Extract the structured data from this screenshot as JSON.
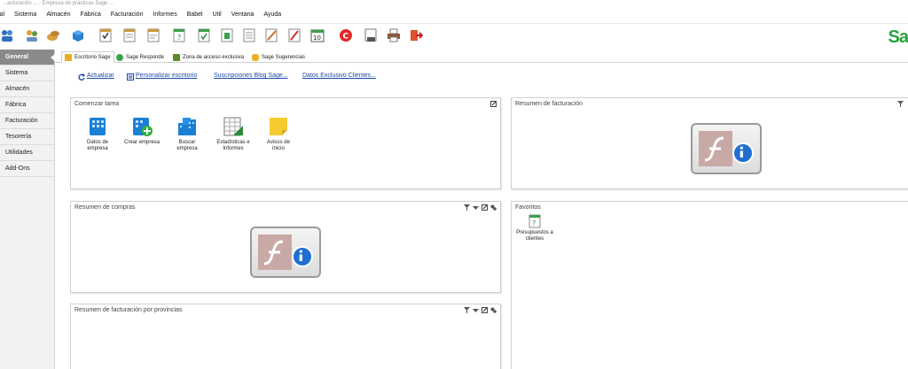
{
  "window": {
    "title": "...acturación ... - Empresa de prácticas Sage ..."
  },
  "menu": [
    "ial",
    "Sistema",
    "Almacén",
    "Fábrica",
    "Facturación",
    "Informes",
    "Babel",
    "Util",
    "Ventana",
    "Ayuda"
  ],
  "toolbar": {
    "icons": [
      "users-icon",
      "people-icon",
      "coins-icon",
      "box-icon",
      "check-document-icon",
      "document-icon",
      "list-icon",
      "question-doc-icon",
      "check-doc-icon",
      "green-doc-icon",
      "doc-icon",
      "edit-doc-icon",
      "cancel-doc-icon",
      "calendar-10-icon",
      "red-c-icon",
      "stamp-icon",
      "printer-icon",
      "exit-icon"
    ],
    "brand": "Sa"
  },
  "sidebar": {
    "items": [
      {
        "label": "General",
        "active": true
      },
      {
        "label": "Sistema",
        "active": false
      },
      {
        "label": "Almacén",
        "active": false
      },
      {
        "label": "Fábrica",
        "active": false
      },
      {
        "label": "Facturación",
        "active": false
      },
      {
        "label": "Tesorería",
        "active": false
      },
      {
        "label": "Utilidades",
        "active": false
      },
      {
        "label": "Add-Ons",
        "active": false
      }
    ]
  },
  "tabs": [
    {
      "label": "Escritorio Sage",
      "active": true
    },
    {
      "label": "Sage Responde",
      "active": false
    },
    {
      "label": "Zona de acceso exclusiva",
      "active": false
    },
    {
      "label": "Sage Sugerencias",
      "active": false
    }
  ],
  "links": {
    "actualizar": "Actualizar",
    "personalizar": "Personalizar escritorio",
    "blog": "Suscripciones Blog Sage...",
    "clientes": "Datos Exclusivo Clientes..."
  },
  "panels": {
    "comenzar": {
      "title": "Comenzar tarea",
      "tasks": [
        {
          "label_1": "Datos de",
          "label_2": "empresa"
        },
        {
          "label_1": "Crear empresa",
          "label_2": ""
        },
        {
          "label_1": "Buscar",
          "label_2": "empresa"
        },
        {
          "label_1": "Estadísticas e",
          "label_2": "Informes"
        },
        {
          "label_1": "Avisos de",
          "label_2": "inicio"
        }
      ]
    },
    "resumen_facturacion": {
      "title": "Resumen de facturación"
    },
    "resumen_compras": {
      "title": "Resumen de compras"
    },
    "favoritos": {
      "title": "Favoritos",
      "item_line1": "Presupuestos a",
      "item_line2": "clientes"
    },
    "resumen_provincias": {
      "title": "Resumen de facturación por provincias"
    }
  },
  "colors": {
    "sidebar_active": "#8a8a8a",
    "link": "#1a47a8",
    "brand_green": "#26a33b",
    "flash_placeholder": "#c9a9a6",
    "info_blue": "#1f6fd1"
  }
}
